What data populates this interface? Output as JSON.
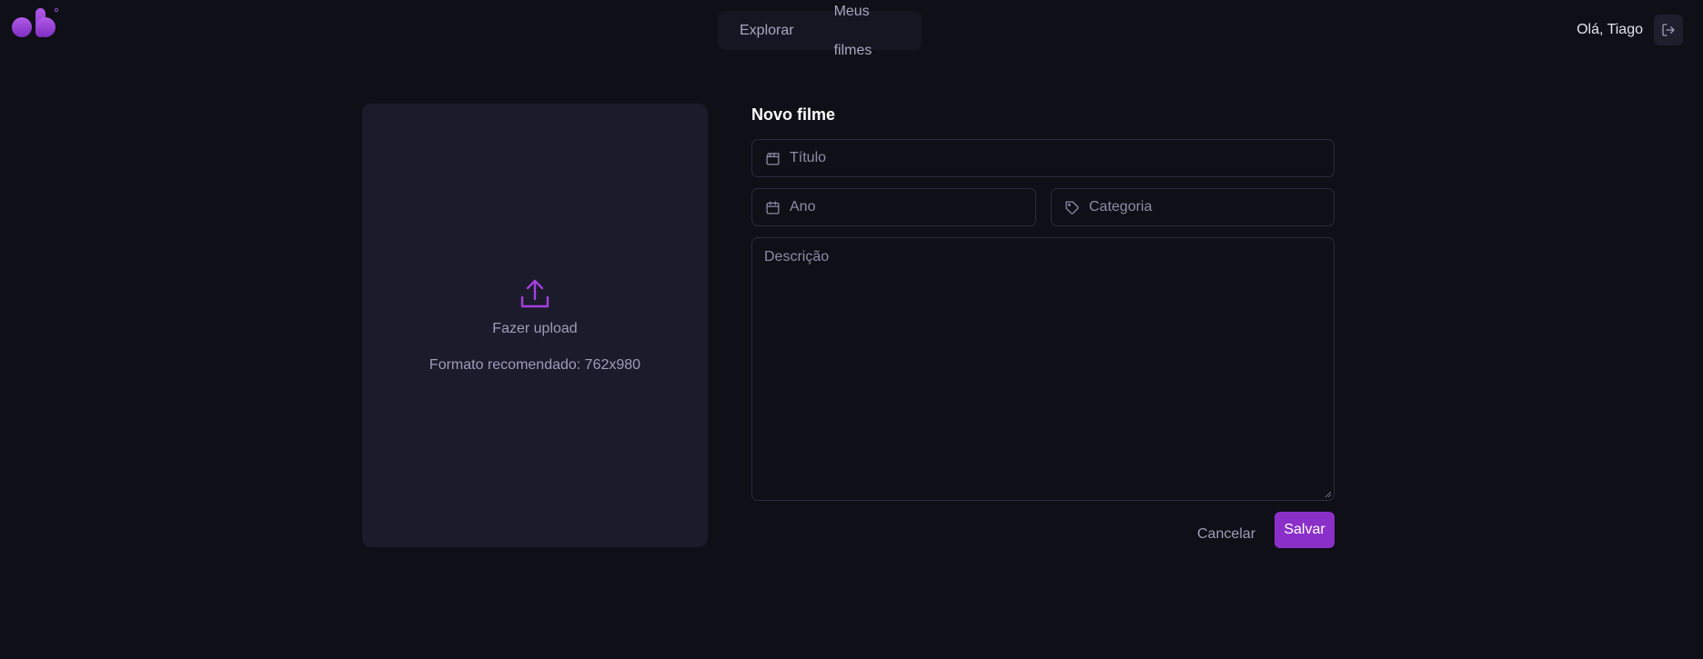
{
  "header": {
    "nav": [
      {
        "label": "Explorar"
      },
      {
        "label": "Meus filmes"
      }
    ],
    "greeting": "Olá, Tiago"
  },
  "upload": {
    "label": "Fazer upload",
    "hint": "Formato recomendado: 762x980"
  },
  "form": {
    "title": "Novo filme",
    "title_placeholder": "Título",
    "year_placeholder": "Ano",
    "category_placeholder": "Categoria",
    "description_placeholder": "Descrição",
    "cancel_label": "Cancelar",
    "save_label": "Salvar"
  },
  "colors": {
    "background": "#0f0f17",
    "accent": "#8b2fc9",
    "panel": "#1b1b2c"
  },
  "icons": {
    "logo": "logo-icon",
    "logout": "logout-icon",
    "upload": "upload-icon",
    "title": "clapperboard-icon",
    "year": "calendar-icon",
    "category": "tag-icon"
  }
}
